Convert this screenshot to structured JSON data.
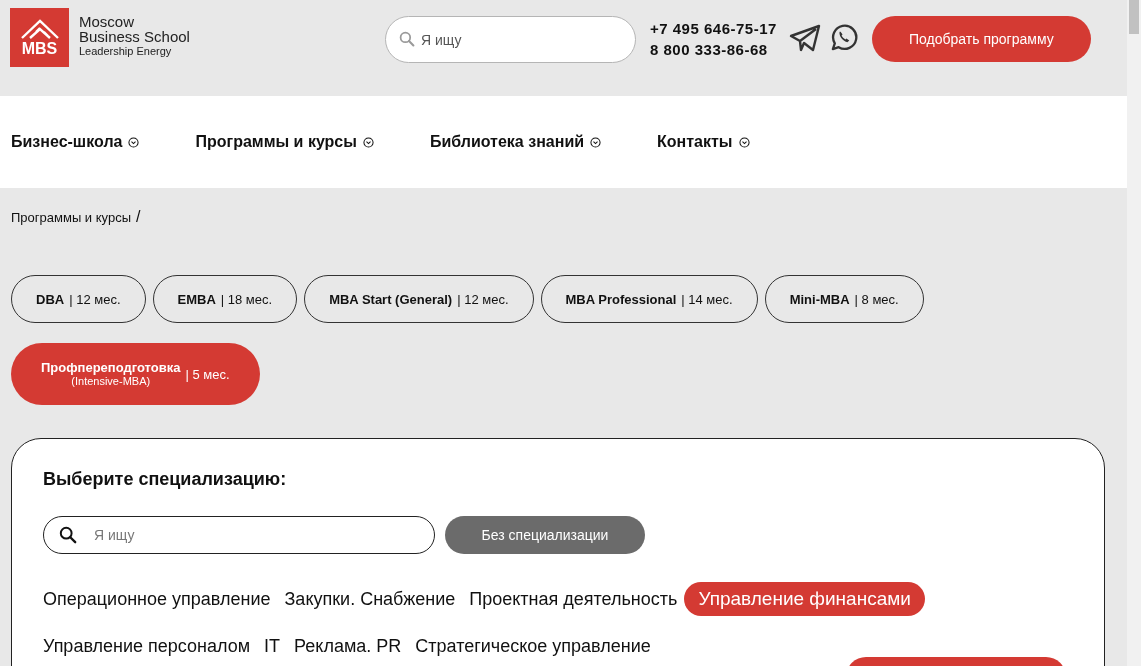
{
  "header": {
    "logo": {
      "mark": "MBS",
      "name_lines": [
        "Moscow",
        "Business School"
      ],
      "tagline": "Leadership Energy"
    },
    "search": {
      "placeholder": "Я ищу"
    },
    "phones": [
      "+7 495 646-75-17",
      "8 800 333-86-68"
    ],
    "cta": "Подобрать программу"
  },
  "nav": [
    {
      "label": "Бизнес-школа"
    },
    {
      "label": "Программы и курсы"
    },
    {
      "label": "Библиотека знаний"
    },
    {
      "label": "Контакты"
    }
  ],
  "breadcrumb": {
    "items": [
      "Программы и курсы"
    ],
    "separator": "/"
  },
  "programs": [
    {
      "name": "DBA",
      "duration": "| 12 мес.",
      "selected": false
    },
    {
      "name": "EMBA",
      "duration": "| 18 мес.",
      "selected": false
    },
    {
      "name": "MBA Start (General)",
      "duration": "| 12 мес.",
      "selected": false
    },
    {
      "name": "MBA Professional",
      "duration": "| 14 мес.",
      "selected": false
    },
    {
      "name": "Mini-MBA",
      "duration": "| 8 мес.",
      "selected": false
    },
    {
      "name": "Профпереподготовка",
      "subtitle": "(Intensive-MBA)",
      "duration": "| 5 мес.",
      "selected": true
    }
  ],
  "specialization": {
    "title": "Выберите специализацию:",
    "search": {
      "placeholder": "Я ищу"
    },
    "no_spec_button": "Без специализации",
    "tags": [
      {
        "label": "Операционное управление",
        "selected": false
      },
      {
        "label": "Закупки. Снабжение",
        "selected": false
      },
      {
        "label": "Проектная деятельность",
        "selected": false
      },
      {
        "label": "Управление финансами",
        "selected": true
      },
      {
        "label": "Управление персоналом",
        "selected": false
      },
      {
        "label": "IT",
        "selected": false
      },
      {
        "label": "Реклама. PR",
        "selected": false
      },
      {
        "label": "Стратегическое управление",
        "selected": false
      }
    ]
  }
}
